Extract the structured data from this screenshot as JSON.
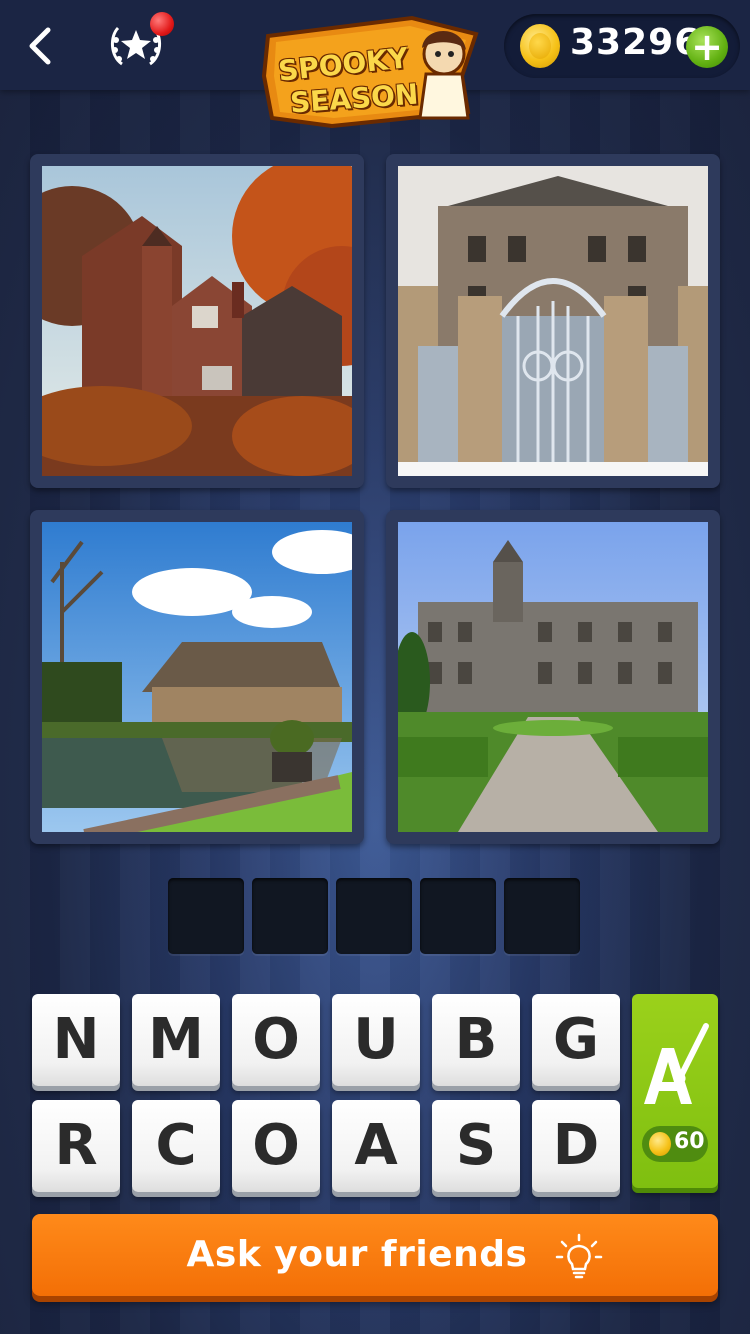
{
  "header": {
    "coins": "33296",
    "logo_line1": "SPOOKY",
    "logo_line2": "SEASON"
  },
  "puzzle": {
    "images": [
      "autumn-brick-manor",
      "ornate-iron-gate-mansion",
      "stone-cottage-by-pond",
      "gothic-manor-garden"
    ],
    "answer_slots": 5
  },
  "letters": {
    "row1": [
      "N",
      "M",
      "O",
      "U",
      "B",
      "G"
    ],
    "row2": [
      "R",
      "C",
      "O",
      "A",
      "S",
      "D"
    ]
  },
  "hint": {
    "icon": "paintbrush-letter-icon",
    "cost": "60"
  },
  "ask_button": {
    "label": "Ask your friends",
    "icon": "lightbulb-icon"
  },
  "colors": {
    "accent_orange": "#f36f06",
    "hint_green": "#7fbf10",
    "coin_gold": "#f6c219",
    "background": "#1f2a48"
  }
}
